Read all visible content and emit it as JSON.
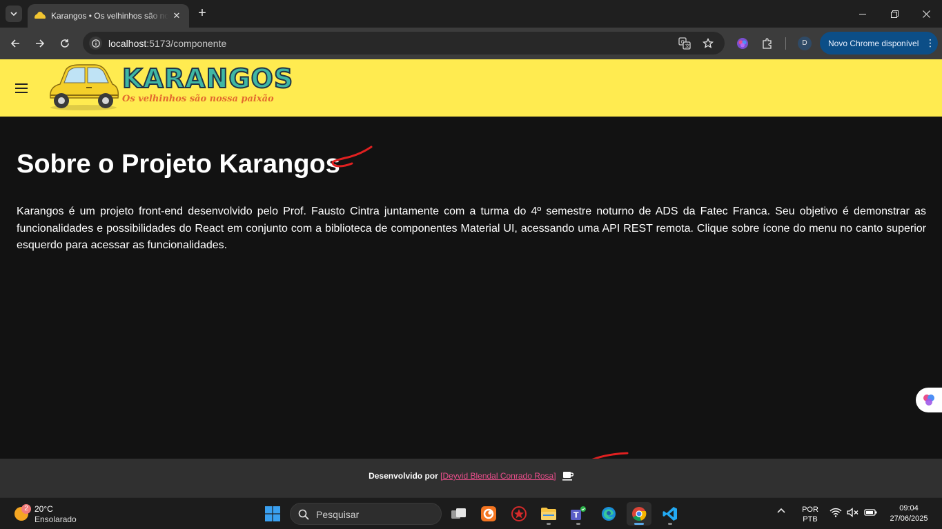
{
  "browser": {
    "tab_title": "Karangos • Os velhinhos são nossa paixão",
    "url_host": "localhost",
    "url_rest": ":5173/componente",
    "profile_initial": "D",
    "update_button": "Novo Chrome disponível"
  },
  "app": {
    "logo_text": "KARANGOS",
    "logo_tagline": "Os velhinhos são nossa paixão",
    "colors": {
      "appbar": "#ffeb50",
      "background": "#121212",
      "footer": "#303030",
      "link": "#e94e8b",
      "annotation": "#e02020"
    }
  },
  "page": {
    "title": "Sobre o Projeto Karangos",
    "body": "Karangos é um projeto front-end desenvolvido pelo Prof. Fausto Cintra juntamente com a turma do 4º semestre noturno de ADS da Fatec Franca. Seu objetivo é demonstrar as funcionalidades e possibilidades do React em conjunto com a biblioteca de componentes Material UI, acessando uma API REST remota. Clique sobre ícone do menu no canto superior esquerdo para acessar as funcionalidades."
  },
  "footer": {
    "prefix": "Desenvolvido por",
    "author_link": "[Deyvid Blendal Conrado Rosa]",
    "icon": "coffee-icon"
  },
  "taskbar": {
    "weather_badge": "2",
    "temperature": "20°C",
    "condition": "Ensolarado",
    "search_placeholder": "Pesquisar",
    "lang_top": "POR",
    "lang_bottom": "PTB",
    "time": "09:04",
    "date": "27/06/2025"
  }
}
